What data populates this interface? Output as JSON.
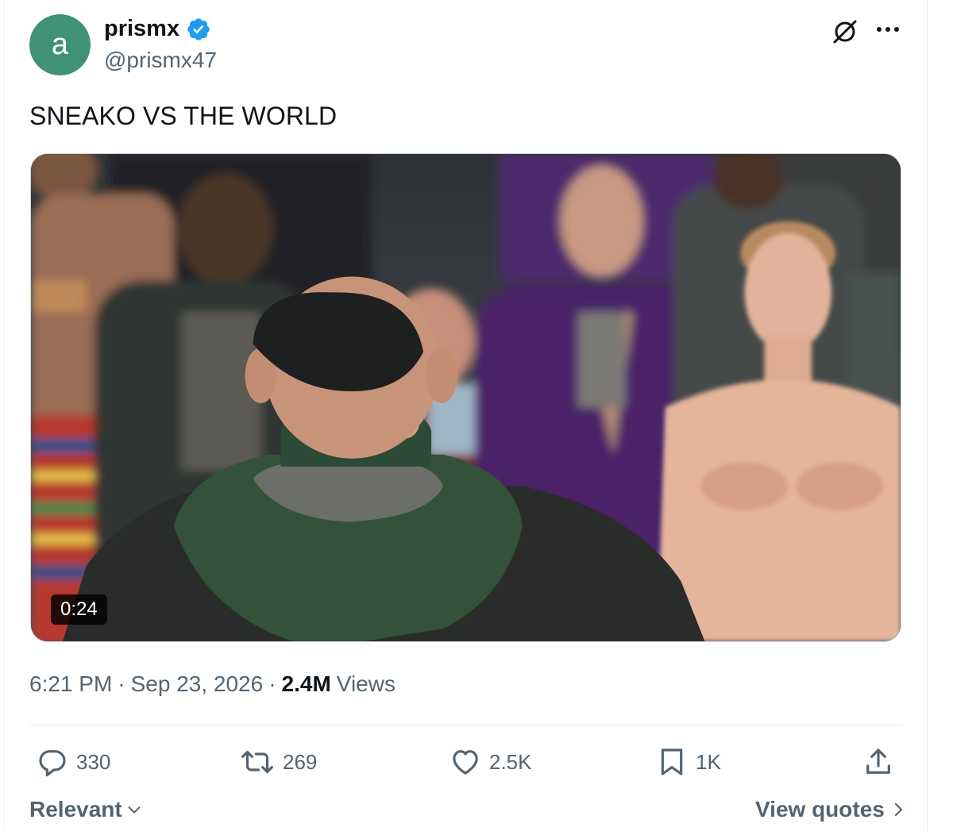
{
  "author": {
    "avatar_letter": "a",
    "avatar_color": "#3f9278",
    "display_name": "prismx",
    "handle": "@prismx47",
    "verified_color": "#1d9bf0"
  },
  "tweet": {
    "text": "SNEAKO VS THE WORLD",
    "media": {
      "type": "video",
      "duration": "0:24"
    }
  },
  "meta": {
    "time": "6:21 PM",
    "separator": "·",
    "date": "Sep 23, 2026",
    "views_count": "2.4M",
    "views_label": "Views"
  },
  "actions": {
    "replies": "330",
    "reposts": "269",
    "likes": "2.5K",
    "bookmarks": "1K"
  },
  "footer": {
    "sort_label": "Relevant",
    "view_quotes_label": "View quotes"
  },
  "icons": {
    "header": [
      "grok-icon",
      "more-icon"
    ],
    "actions": [
      "reply-icon",
      "repost-icon",
      "like-icon",
      "bookmark-icon",
      "share-icon"
    ]
  }
}
